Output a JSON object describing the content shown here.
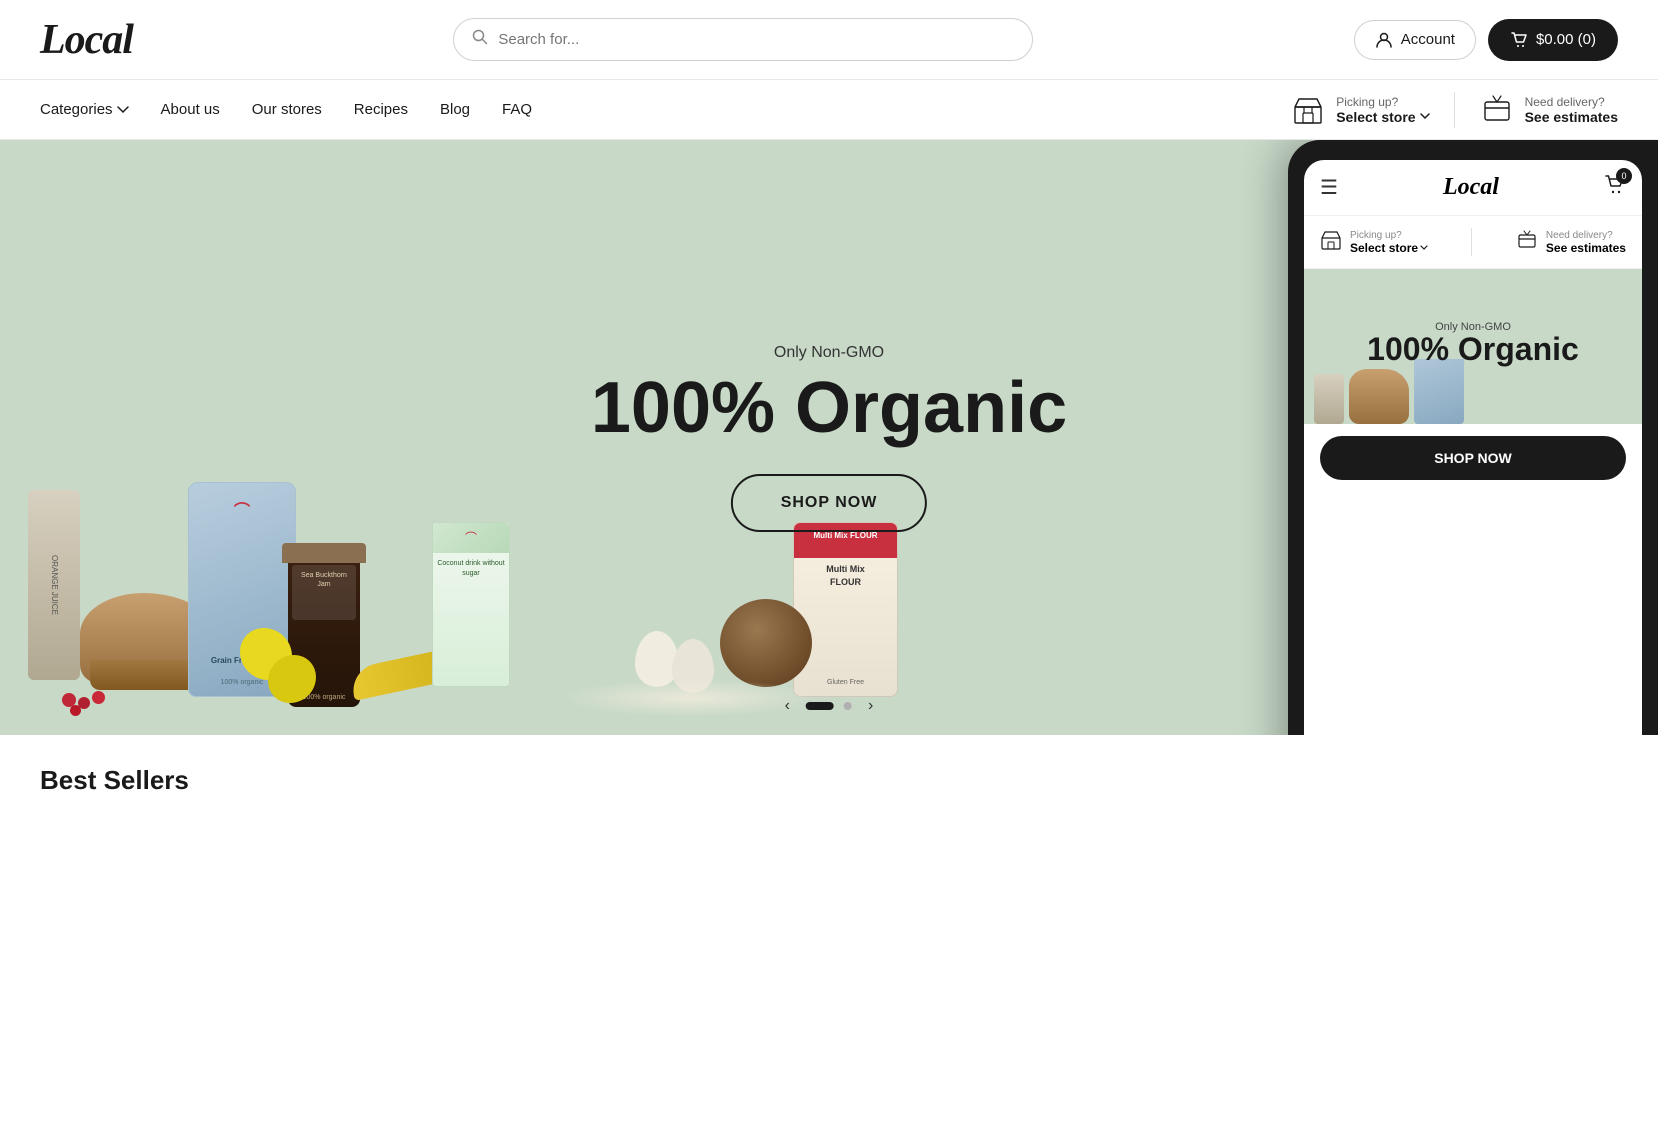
{
  "logo": {
    "text": "Local"
  },
  "search": {
    "placeholder": "Search for..."
  },
  "header": {
    "account_label": "Account",
    "cart_label": "$0.00 (0)"
  },
  "nav": {
    "categories_label": "Categories",
    "items": [
      {
        "id": "about-us",
        "label": "About us"
      },
      {
        "id": "our-stores",
        "label": "Our stores"
      },
      {
        "id": "recipes",
        "label": "Recipes"
      },
      {
        "id": "blog",
        "label": "Blog"
      },
      {
        "id": "faq",
        "label": "FAQ"
      }
    ],
    "store_picker": {
      "label": "Picking up?",
      "action": "Select store"
    },
    "delivery_picker": {
      "label": "Need delivery?",
      "action": "See estimates"
    }
  },
  "hero": {
    "subtitle": "Only Non-GMO",
    "title": "100% Organic",
    "cta": "SHOP NOW",
    "carousel_dots": [
      {
        "active": true
      },
      {
        "active": false
      }
    ]
  },
  "phone": {
    "logo": "Local",
    "cart_badge": "0",
    "store_label": "Picking up?",
    "store_action": "Select store",
    "delivery_label": "Need delivery?",
    "delivery_action": "See estimates",
    "hero_subtitle": "Only Non-GMO",
    "hero_title": "100% Organic",
    "cta": "SHOP NOW"
  },
  "best_sellers": {
    "title": "Best Sellers"
  },
  "products": {
    "can_label": "ORANGE JUICE",
    "bag_label": "Grain Free Puffs",
    "carton_label": "Coconut drink without sugar",
    "flour_label": "Multi Mix FLOUR",
    "jam_label": "Sea Buckthorn Jam"
  }
}
